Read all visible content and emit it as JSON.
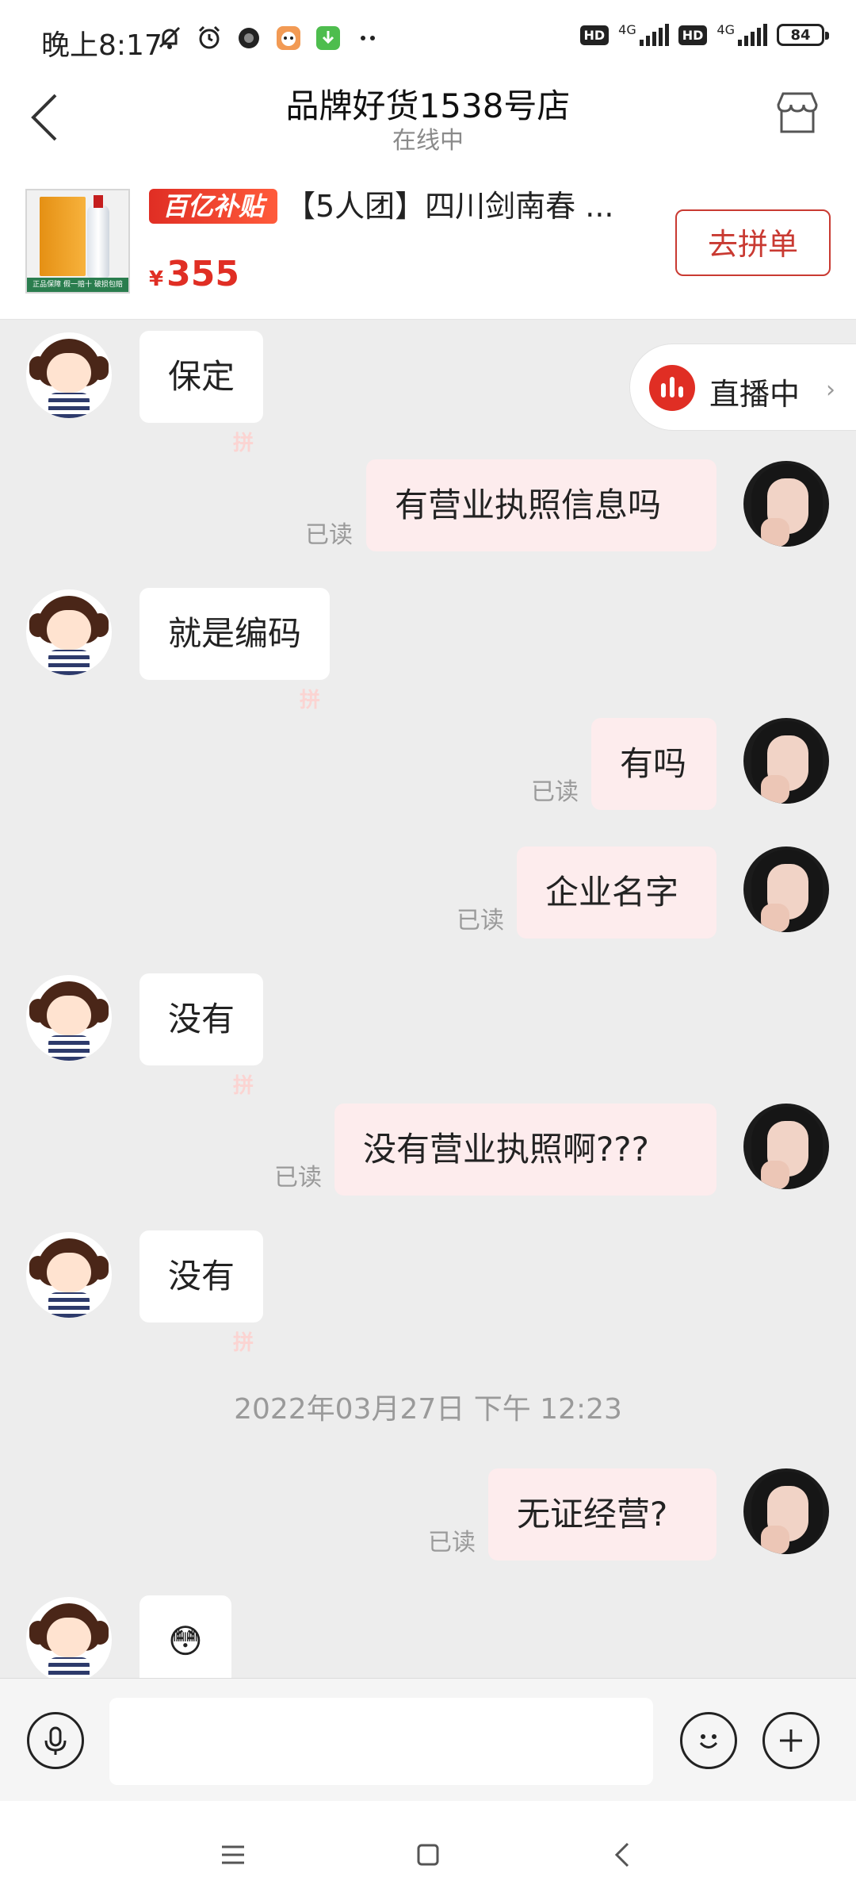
{
  "status_bar": {
    "time": "晚上8:17",
    "signal_1": "4G",
    "signal_2": "4G",
    "hd_1": "HD",
    "hd_2": "HD",
    "battery": "84"
  },
  "header": {
    "title": "品牌好货1538号店",
    "subtitle": "在线中"
  },
  "product": {
    "badge": "百亿补贴",
    "title": "【5人团】四川剑南春 ...",
    "currency": "¥",
    "price": "355",
    "image_strip": "正品保障 假一赔十 破损包赔",
    "button": "去拼单"
  },
  "live": {
    "label": "直播中",
    "arrow": "›"
  },
  "messages": [
    {
      "side": "in",
      "text": "保定"
    },
    {
      "side": "out",
      "text": "有营业执照信息吗",
      "read": "已读"
    },
    {
      "side": "in",
      "text": "就是编码"
    },
    {
      "side": "out",
      "text": "有吗",
      "read": "已读"
    },
    {
      "side": "out",
      "text": "企业名字",
      "read": "已读"
    },
    {
      "side": "in",
      "text": "没有"
    },
    {
      "side": "out",
      "text": "没有营业执照啊???",
      "read": "已读"
    },
    {
      "side": "in",
      "text": "没有"
    },
    {
      "side": "out",
      "text": "无证经营?",
      "read": "已读"
    },
    {
      "side": "in",
      "text": "😳"
    }
  ],
  "timestamp": "2022年03月27日 下午 12:23",
  "watermark": "拼",
  "input": {
    "placeholder": ""
  }
}
